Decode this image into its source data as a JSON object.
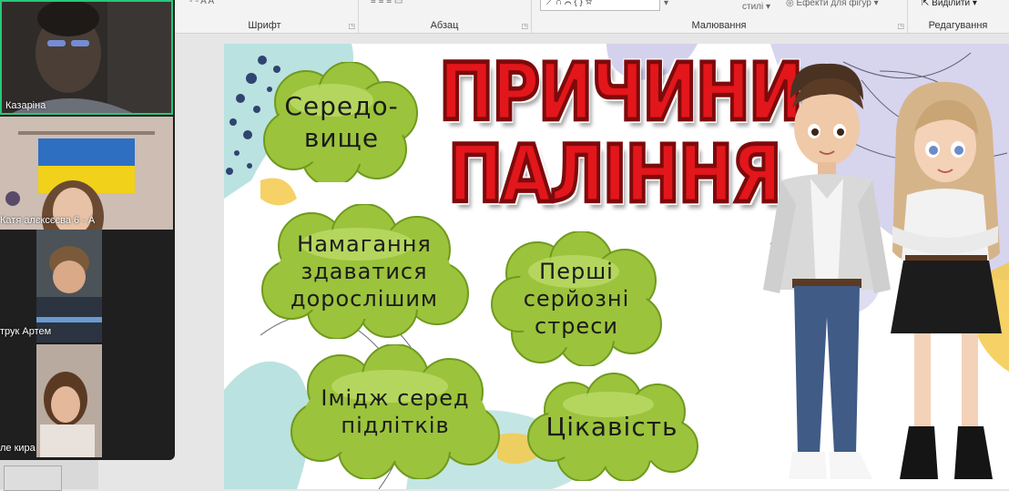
{
  "ribbon": {
    "groups": {
      "font": "Шрифт",
      "paragraph": "Абзац",
      "drawing": "Малювання",
      "editing": "Редагування"
    },
    "styles_label": "стилі",
    "shape_effects_label": "Ефекти для фігур",
    "select_label": "Виділити"
  },
  "participants": [
    {
      "name": "Казаріна"
    },
    {
      "name": "Катя алєксєєва 6 - А"
    },
    {
      "name": "трук Артем"
    },
    {
      "name": "ле кира"
    }
  ],
  "slide": {
    "title_line1": "ПРИЧИНИ",
    "title_line2": "ПАЛІННЯ",
    "clouds": [
      {
        "line1": "Середо-",
        "line2": "вище"
      },
      {
        "line1": "Намагання",
        "line2": "здаватися",
        "line3": "дорослішим"
      },
      {
        "line1": "Перші",
        "line2": "серйозні",
        "line3": "стреси"
      },
      {
        "line1": "Імідж серед",
        "line2": "підлітків"
      },
      {
        "line1": "Цікавість"
      }
    ]
  },
  "colors": {
    "title_red": "#e3161b",
    "cloud_green": "#9cc33c",
    "active_speaker_border": "#27c77a"
  }
}
